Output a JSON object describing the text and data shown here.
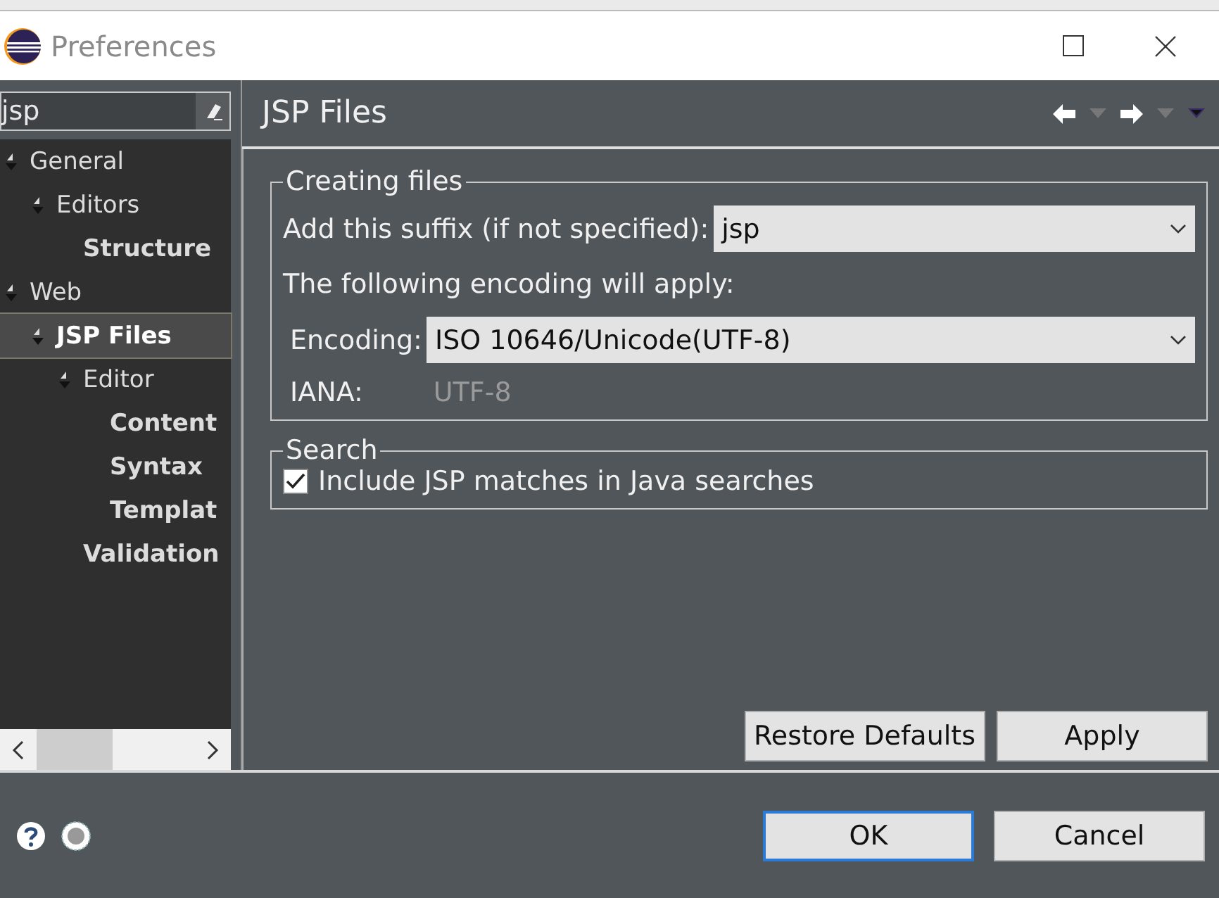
{
  "window": {
    "title": "Preferences"
  },
  "filter": {
    "value": "jsp"
  },
  "tree": [
    {
      "label": "General",
      "expanded": true,
      "matched": false,
      "selected": false,
      "children": [
        {
          "label": "Editors",
          "expanded": true,
          "matched": false,
          "selected": false,
          "children": [
            {
              "label": "Structure",
              "matched": true,
              "selected": false
            }
          ]
        }
      ]
    },
    {
      "label": "Web",
      "expanded": true,
      "matched": false,
      "selected": false,
      "children": [
        {
          "label": "JSP Files",
          "expanded": true,
          "matched": true,
          "selected": true,
          "children": [
            {
              "label": "Editor",
              "expanded": true,
              "matched": false,
              "selected": false,
              "children": [
                {
                  "label": "Content",
                  "matched": true,
                  "selected": false
                },
                {
                  "label": "Syntax",
                  "matched": true,
                  "selected": false
                },
                {
                  "label": "Templat",
                  "matched": true,
                  "selected": false
                }
              ]
            },
            {
              "label": "Validation",
              "matched": true,
              "selected": false
            }
          ]
        }
      ]
    }
  ],
  "page": {
    "title": "JSP Files"
  },
  "creating_files": {
    "title": "Creating files",
    "suffix_label": "Add this suffix (if not specified):",
    "suffix_value": "jsp",
    "encoding_note": "The following encoding will apply:",
    "encoding_label": "Encoding:",
    "encoding_value": "ISO 10646/Unicode(UTF-8)",
    "iana_label": "IANA:",
    "iana_value": "UTF-8"
  },
  "search": {
    "title": "Search",
    "option": {
      "label": "Include JSP matches in Java searches",
      "checked": true
    }
  },
  "page_buttons": [
    "Restore Defaults",
    "Apply"
  ],
  "dialog_buttons": [
    {
      "label": "OK",
      "default": true
    },
    {
      "label": "Cancel",
      "default": false
    }
  ]
}
